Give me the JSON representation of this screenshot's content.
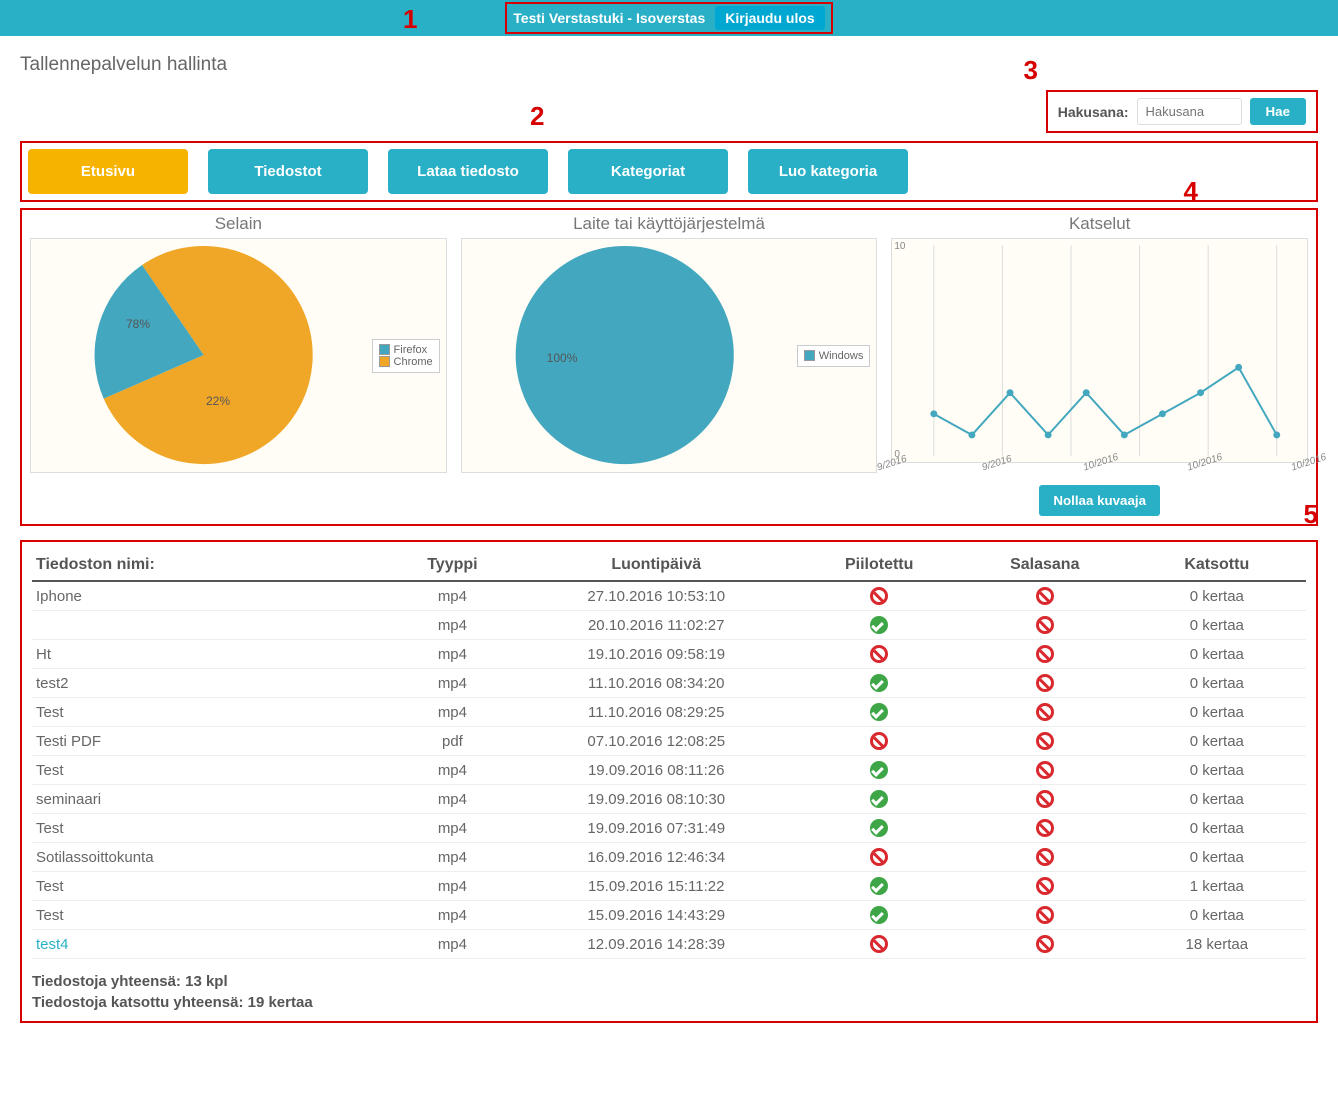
{
  "topbar": {
    "title": "Testi Verstastuki - Isoverstas",
    "logout": "Kirjaudu ulos"
  },
  "annotations": {
    "a1": "1",
    "a2": "2",
    "a3": "3",
    "a4": "4",
    "a5": "5"
  },
  "page_title": "Tallennepalvelun hallinta",
  "search": {
    "label": "Hakusana:",
    "placeholder": "Hakusana",
    "button": "Hae"
  },
  "nav": {
    "etusivu": "Etusivu",
    "tiedostot": "Tiedostot",
    "lataa": "Lataa tiedosto",
    "kategoriat": "Kategoriat",
    "luo": "Luo kategoria"
  },
  "charts": {
    "browser_title": "Selain",
    "device_title": "Laite tai käyttöjärjestelmä",
    "views_title": "Katselut",
    "legend1": {
      "firefox": "Firefox",
      "chrome": "Chrome"
    },
    "legend2": {
      "windows": "Windows"
    },
    "pie1_label_a": "78%",
    "pie1_label_b": "22%",
    "pie2_label": "100%",
    "reset": "Nollaa kuvaaja",
    "ytick_top": "10",
    "ytick_bot": "0",
    "xticks": [
      "9/2016",
      "9/2016",
      "10/2016",
      "10/2016",
      "10/2016"
    ]
  },
  "chart_data": [
    {
      "type": "pie",
      "title": "Selain",
      "series": [
        {
          "name": "Chrome",
          "value": 78
        },
        {
          "name": "Firefox",
          "value": 22
        }
      ]
    },
    {
      "type": "pie",
      "title": "Laite tai käyttöjärjestelmä",
      "series": [
        {
          "name": "Windows",
          "value": 100
        }
      ]
    },
    {
      "type": "line",
      "title": "Katselut",
      "ylim": [
        0,
        10
      ],
      "x": [
        "9/2016",
        "9/2016",
        "9/2016",
        "9/2016",
        "9/2016",
        "10/2016",
        "10/2016",
        "10/2016",
        "10/2016",
        "10/2016"
      ],
      "values": [
        2.0,
        1.0,
        3.0,
        1.0,
        3.0,
        1.0,
        2.0,
        3.0,
        4.2,
        1.0
      ]
    }
  ],
  "table": {
    "headers": {
      "name": "Tiedoston nimi:",
      "type": "Tyyppi",
      "date": "Luontipäivä",
      "hidden": "Piilotettu",
      "password": "Salasana",
      "viewed": "Katsottu"
    },
    "rows": [
      {
        "name": "Iphone",
        "type": "mp4",
        "date": "27.10.2016 10:53:10",
        "hidden": false,
        "password": false,
        "viewed": "0 kertaa"
      },
      {
        "name": "",
        "type": "mp4",
        "date": "20.10.2016 11:02:27",
        "hidden": true,
        "password": false,
        "viewed": "0 kertaa"
      },
      {
        "name": "Ht",
        "type": "mp4",
        "date": "19.10.2016 09:58:19",
        "hidden": false,
        "password": false,
        "viewed": "0 kertaa"
      },
      {
        "name": "test2",
        "type": "mp4",
        "date": "11.10.2016 08:34:20",
        "hidden": true,
        "password": false,
        "viewed": "0 kertaa"
      },
      {
        "name": "Test",
        "type": "mp4",
        "date": "11.10.2016 08:29:25",
        "hidden": true,
        "password": false,
        "viewed": "0 kertaa"
      },
      {
        "name": "Testi PDF",
        "type": "pdf",
        "date": "07.10.2016 12:08:25",
        "hidden": false,
        "password": false,
        "viewed": "0 kertaa"
      },
      {
        "name": "Test",
        "type": "mp4",
        "date": "19.09.2016 08:11:26",
        "hidden": true,
        "password": false,
        "viewed": "0 kertaa"
      },
      {
        "name": "seminaari",
        "type": "mp4",
        "date": "19.09.2016 08:10:30",
        "hidden": true,
        "password": false,
        "viewed": "0 kertaa"
      },
      {
        "name": "Test",
        "type": "mp4",
        "date": "19.09.2016 07:31:49",
        "hidden": true,
        "password": false,
        "viewed": "0 kertaa"
      },
      {
        "name": "Sotilassoittokunta",
        "type": "mp4",
        "date": "16.09.2016 12:46:34",
        "hidden": false,
        "password": false,
        "viewed": "0 kertaa"
      },
      {
        "name": "Test",
        "type": "mp4",
        "date": "15.09.2016 15:11:22",
        "hidden": true,
        "password": false,
        "viewed": "1 kertaa"
      },
      {
        "name": "Test",
        "type": "mp4",
        "date": "15.09.2016 14:43:29",
        "hidden": true,
        "password": false,
        "viewed": "0 kertaa"
      },
      {
        "name": "test4",
        "type": "mp4",
        "date": "12.09.2016 14:28:39",
        "hidden": false,
        "password": false,
        "viewed": "18 kertaa",
        "link": true
      }
    ]
  },
  "summary": {
    "count": "Tiedostoja yhteensä: 13 kpl",
    "views": "Tiedostoja katsottu yhteensä: 19 kertaa"
  },
  "colors": {
    "chrome": "#f0a728",
    "firefox": "#43a8bf",
    "windows": "#43a8bf",
    "line": "#43a8bf"
  }
}
